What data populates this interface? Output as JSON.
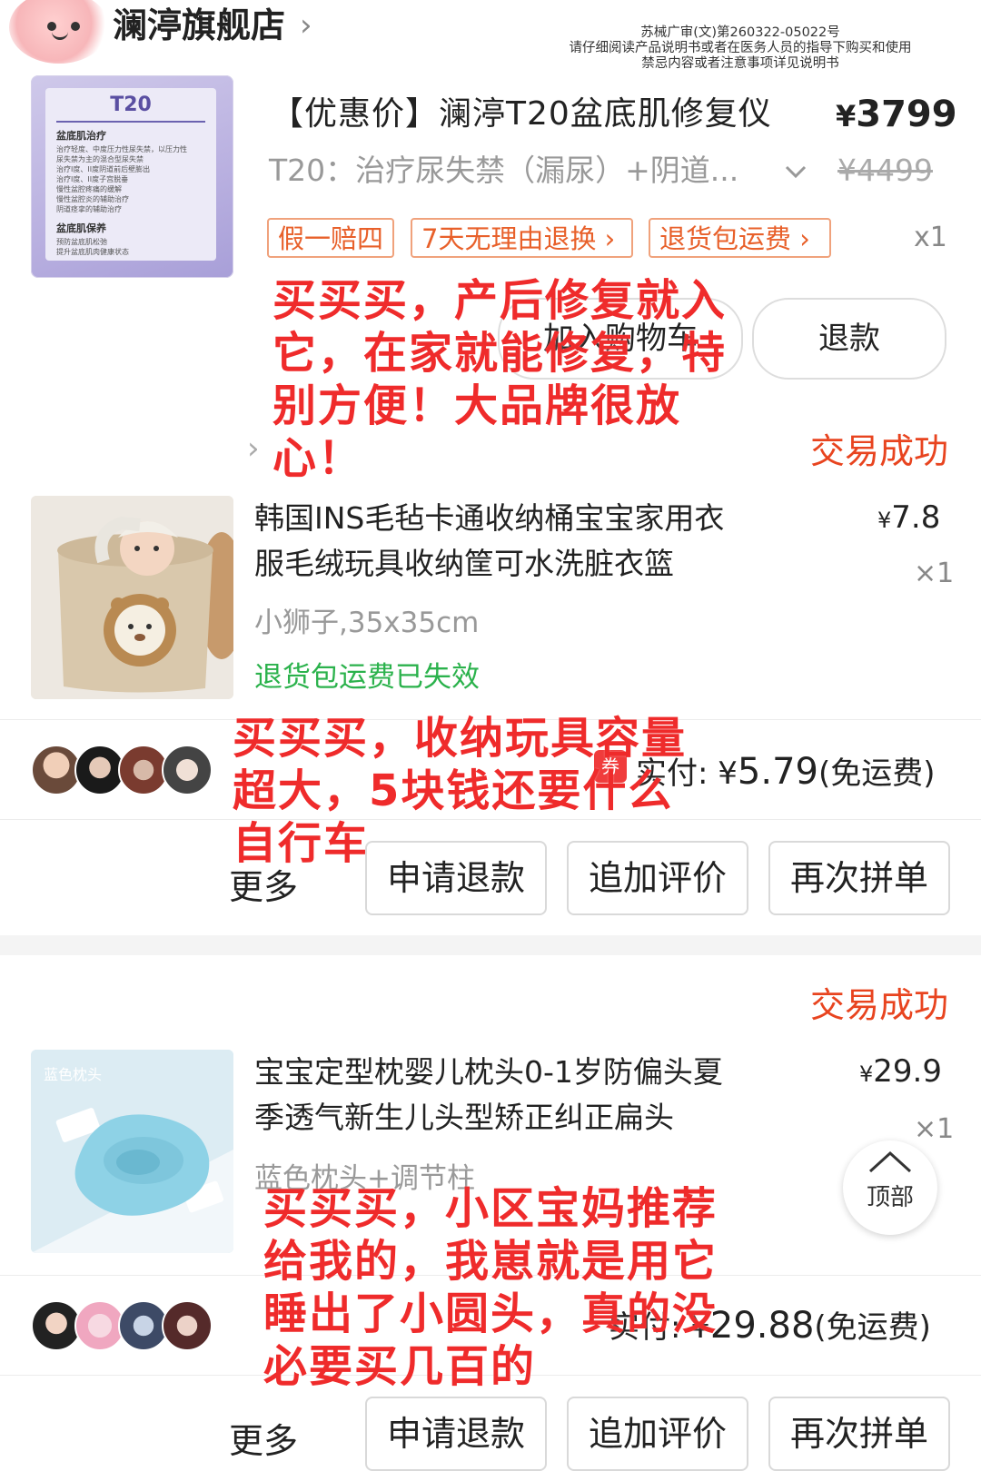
{
  "store": {
    "name": "澜渟旗舰店",
    "chevron": "›"
  },
  "notice": {
    "line1": "苏械广审(文)第260322-05022号",
    "line2": "请仔细阅读产品说明书或者在医务人员的指导下购买和使用",
    "line3": "禁忌内容或者注意事项详见说明书"
  },
  "product1": {
    "image": {
      "model": "T20",
      "section1": "盆底肌治疗",
      "items1": [
        "治疗轻度、中度压力性尿失禁，以压力性",
        "尿失禁为主的混合型尿失禁",
        "治疗I度、II度阴道前后壁膨出",
        "治疗I度、II度子宫脱垂",
        "慢性盆腔疼痛的缓解",
        "慢性盆腔炎的辅助治疗",
        "阴道痉挛的辅助治疗"
      ],
      "section2": "盆底肌保养",
      "items2": [
        "预防盆底肌松弛",
        "提升盆底肌肉健康状态"
      ]
    },
    "title": "【优惠价】澜渟T20盆底肌修复仪",
    "price_symbol": "¥",
    "price": "3799",
    "spec": "T20：治疗尿失禁（漏尿）+阴道...",
    "original_price": "¥4499",
    "tags": [
      "假一赔四",
      "7天无理由退换 ›",
      "退货包运费 ›"
    ],
    "qty": "x1",
    "btn_cart": "加入购物车",
    "btn_refund": "退款"
  },
  "overlay1": "买买买，产后修复就入\n它，在家就能修复，特\n别方便！大品牌很放\n心！",
  "order2": {
    "status": "交易成功",
    "title_line1": "韩国INS毛毡卡通收纳桶宝宝家用衣",
    "title_line2": "服毛绒玩具收纳筐可水洗脏衣篮",
    "price_symbol": "¥",
    "price": "7.8",
    "qty": "×1",
    "spec": "小狮子,35x35cm",
    "notice": "退货包运费已失效",
    "coupon_icon": "券",
    "paid_label": "实付: ",
    "paid_symbol": "¥",
    "paid_amount": "5.79",
    "shipping": "(免运费)",
    "more": "更多",
    "btn_refund": "申请退款",
    "btn_review": "追加评价",
    "btn_rebuy": "再次拼单"
  },
  "overlay2": "买买买，收纳玩具容量\n超大，5块钱还要什么\n自行车",
  "order3": {
    "status": "交易成功",
    "image_label": "蓝色枕头",
    "title_line1": "宝宝定型枕婴儿枕头0-1岁防偏头夏",
    "title_line2": "季透气新生儿头型矫正纠正扁头",
    "price_symbol": "¥",
    "price": "29.9",
    "qty": "×1",
    "spec": "蓝色枕头+调节柱",
    "paid_label": "实付: ",
    "paid_symbol": "¥",
    "paid_amount": "29.88",
    "shipping": "(免运费)",
    "more": "更多",
    "btn_refund": "申请退款",
    "btn_review": "追加评价",
    "btn_rebuy": "再次拼单"
  },
  "overlay3": "买买买，小区宝妈推荐\n给我的，我崽就是用它\n睡出了小圆头，真的没\n必要买几百的",
  "top_button": {
    "label": "顶部",
    "icon": "chevron-up-icon"
  },
  "colors": {
    "overlay_red": "#ef2b2b",
    "status_orange": "#e8441f",
    "tag_orange": "#e8602a",
    "green": "#2bb24c"
  }
}
